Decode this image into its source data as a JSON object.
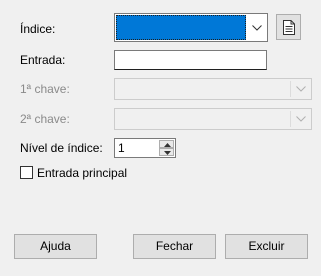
{
  "labels": {
    "index": "Índice:",
    "entry": "Entrada:",
    "key1": "1ª chave:",
    "key2": "2ª chave:",
    "level": "Nível de índice:",
    "main_entry": "Entrada principal"
  },
  "index_combo": {
    "value": ""
  },
  "entry_field": {
    "value": ""
  },
  "level_spin": {
    "value": "1"
  },
  "buttons": {
    "help": "Ajuda",
    "close": "Fechar",
    "delete": "Excluir"
  },
  "icons": {
    "dropdown": "chevron-down-icon",
    "new_index": "document-icon",
    "spin_up": "triangle-up-icon",
    "spin_down": "triangle-down-icon"
  },
  "colors": {
    "selection": "#0078d7",
    "background": "#f0f0f0",
    "disabled_text": "#8a8a8a"
  }
}
